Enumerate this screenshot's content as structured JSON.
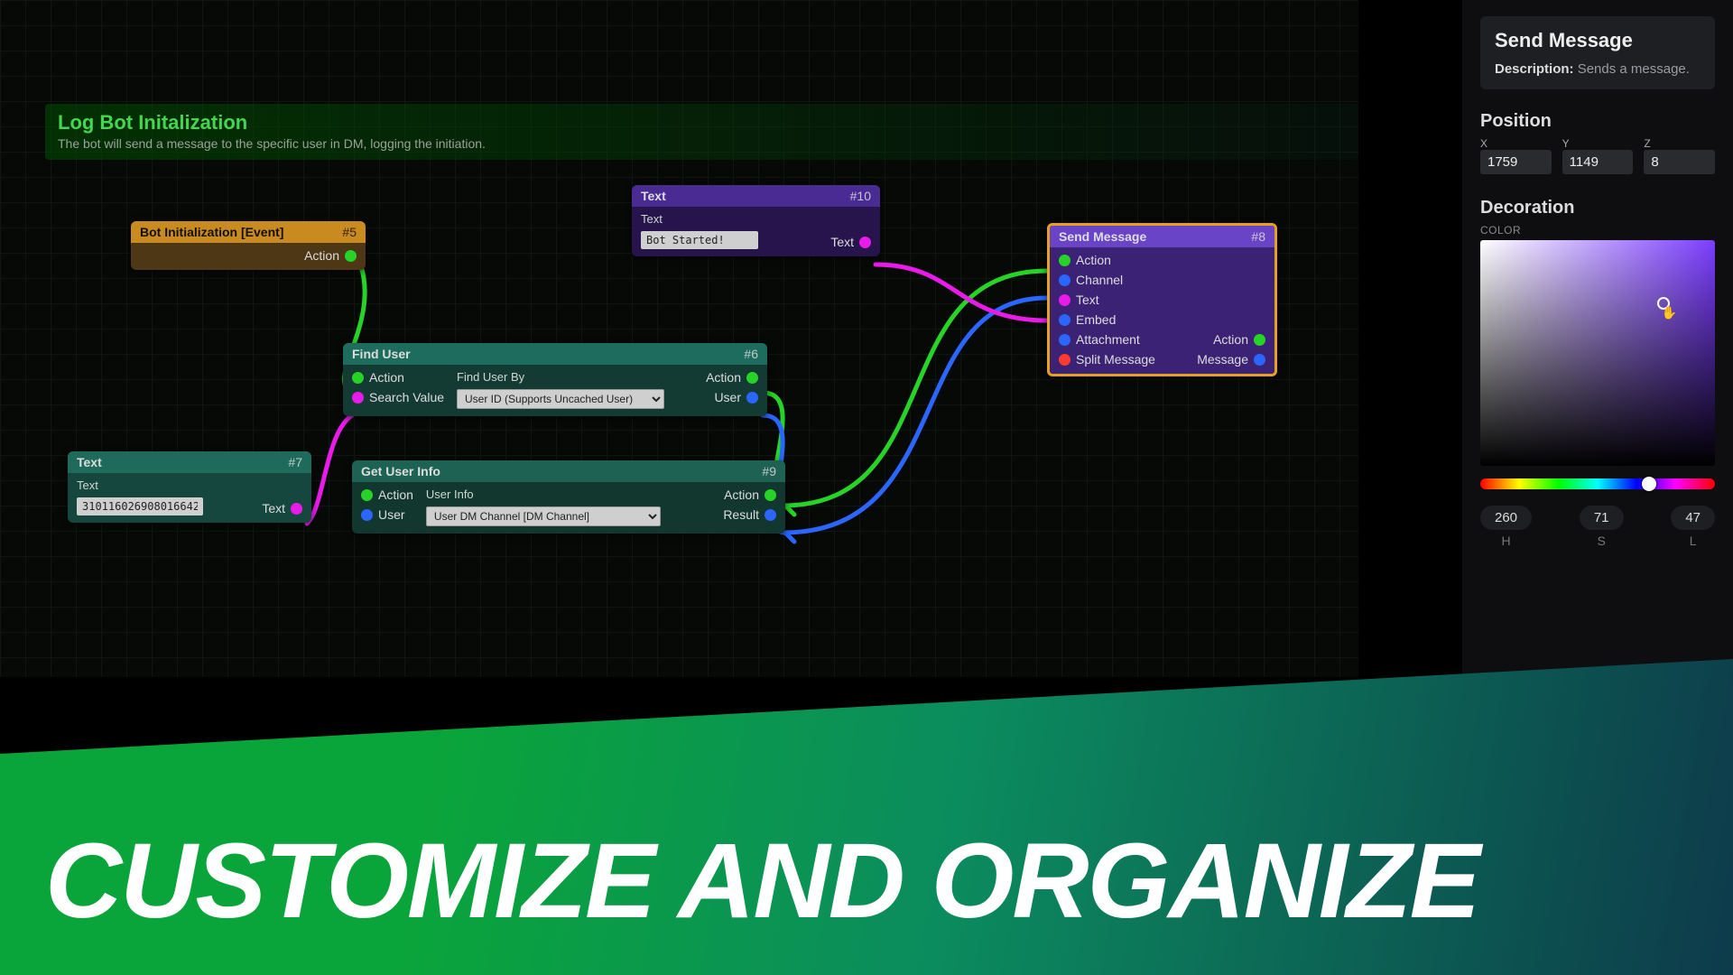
{
  "graph": {
    "title": "Log Bot Initalization",
    "subtitle": "The bot will send a message to the specific user in DM, logging the initiation."
  },
  "nodes": {
    "n5": {
      "title": "Bot Initialization [Event]",
      "num": "#5",
      "out_action": "Action"
    },
    "n7": {
      "title": "Text",
      "num": "#7",
      "field_label": "Text",
      "field_value": "310116026908016642",
      "out_text": "Text"
    },
    "n6": {
      "title": "Find User",
      "num": "#6",
      "in_action": "Action",
      "in_search": "Search Value",
      "mid_label": "Find User By",
      "mid_value": "User ID (Supports Uncached User)",
      "out_action": "Action",
      "out_user": "User"
    },
    "n9": {
      "title": "Get User Info",
      "num": "#9",
      "in_action": "Action",
      "in_user": "User",
      "mid_label": "User Info",
      "mid_value": "User DM Channel [DM Channel]",
      "out_action": "Action",
      "out_result": "Result"
    },
    "n10": {
      "title": "Text",
      "num": "#10",
      "field_label": "Text",
      "field_value": "Bot Started!",
      "out_text": "Text"
    },
    "n8": {
      "title": "Send Message",
      "num": "#8",
      "in_action": "Action",
      "in_channel": "Channel",
      "in_text": "Text",
      "in_embed": "Embed",
      "in_attachment": "Attachment",
      "in_split": "Split Message",
      "out_action": "Action",
      "out_message": "Message"
    }
  },
  "sidebar": {
    "title": "Send Message",
    "desc_label": "Description:",
    "desc_text": "Sends a message.",
    "position_title": "Position",
    "x_label": "X",
    "y_label": "Y",
    "z_label": "Z",
    "x": "1759",
    "y": "1149",
    "z": "8",
    "decoration_title": "Decoration",
    "color_label": "COLOR",
    "h": "260",
    "s": "71",
    "l": "47",
    "h_label": "H",
    "s_label": "S",
    "l_label": "L"
  },
  "banner": "CUSTOMIZE AND ORGANIZE"
}
